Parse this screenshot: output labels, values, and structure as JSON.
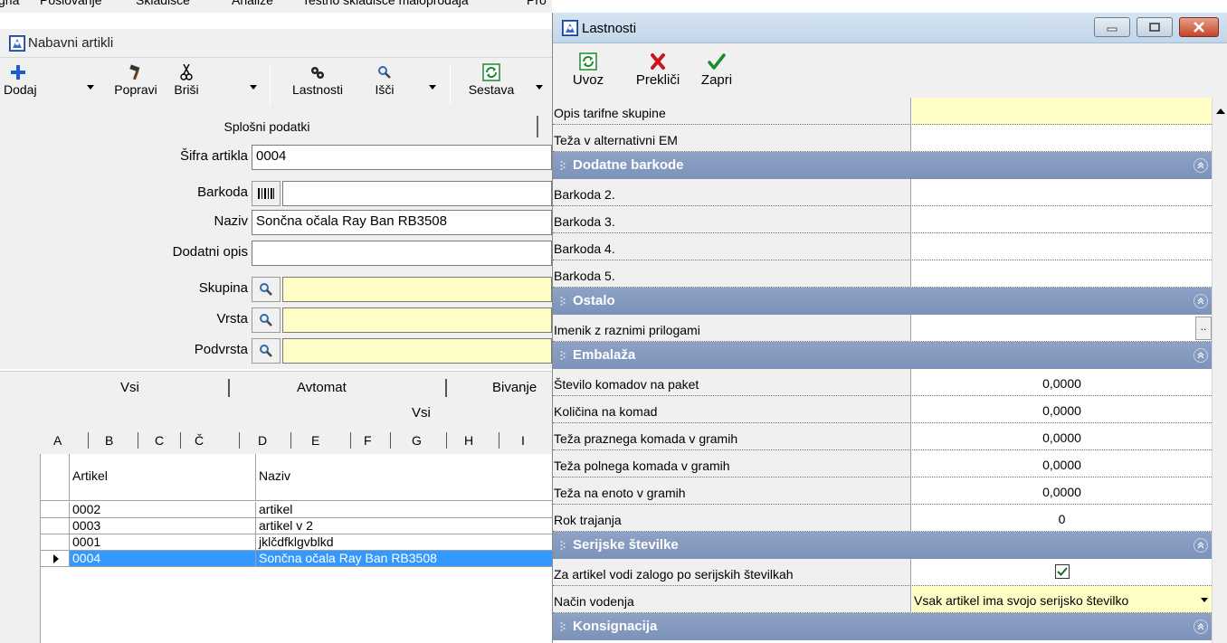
{
  "background_app": {
    "menu": [
      "gna",
      "Poslovanje",
      "Skladišče",
      "Analize",
      "Testno skladišče maloprodaja",
      "Pro"
    ],
    "window_title": "Nabavni artikli",
    "toolbar": {
      "add": "Dodaj",
      "edit": "Popravi",
      "delete": "Briši",
      "properties": "Lastnosti",
      "search": "Išči",
      "compose": "Sestava"
    },
    "section_title": "Splošni podatki",
    "form": {
      "code_label": "Šifra artikla",
      "code_value": "0004",
      "barcode_label": "Barkoda",
      "barcode_value": "",
      "name_label": "Naziv",
      "name_value": "Sončna očala Ray Ban RB3508",
      "extra_label": "Dodatni opis",
      "extra_value": "",
      "group_label": "Skupina",
      "type_label": "Vrsta",
      "subtype_label": "Podvrsta"
    },
    "tabs": [
      "Vsi",
      "Avtomat",
      "Bivanje"
    ],
    "filter_label": "Vsi",
    "letters": [
      "A",
      "B",
      "C",
      "Č",
      "D",
      "E",
      "F",
      "G",
      "H",
      "I"
    ],
    "grid": {
      "columns": [
        "Artikel",
        "Naziv"
      ],
      "rows": [
        {
          "code": "0002",
          "name": "artikel"
        },
        {
          "code": "0003",
          "name": "artikel v 2"
        },
        {
          "code": "0001",
          "name": "jklčdfklgvblkd"
        },
        {
          "code": "0004",
          "name": "Sončna očala Ray Ban RB3508"
        }
      ],
      "selected_index": 3
    }
  },
  "dialog": {
    "title": "Lastnosti",
    "toolbar": {
      "import": "Uvoz",
      "cancel": "Prekliči",
      "close": "Zapri"
    },
    "properties": {
      "tariff_desc": {
        "label": "Opis tarifne skupine",
        "value": ""
      },
      "alt_weight": {
        "label": "Teža v alternativni EM",
        "value": ""
      },
      "cat_barcodes": "Dodatne barkode",
      "barcode2": {
        "label": "Barkoda 2.",
        "value": ""
      },
      "barcode3": {
        "label": "Barkoda 3.",
        "value": ""
      },
      "barcode4": {
        "label": "Barkoda 4.",
        "value": ""
      },
      "barcode5": {
        "label": "Barkoda 5.",
        "value": ""
      },
      "cat_other": "Ostalo",
      "attachments_dir": {
        "label": "Imenik z raznimi prilogami",
        "value": ""
      },
      "cat_packaging": "Embalaža",
      "pieces_per_pack": {
        "label": "Število komadov na paket",
        "value": "0,0000"
      },
      "qty_per_piece": {
        "label": "Količina na komad",
        "value": "0,0000"
      },
      "empty_weight": {
        "label": "Teža praznega komada v gramih",
        "value": "0,0000"
      },
      "full_weight": {
        "label": "Teža polnega komada v gramih",
        "value": "0,0000"
      },
      "unit_weight": {
        "label": "Teža na enoto v gramih",
        "value": "0,0000"
      },
      "shelf_life": {
        "label": "Rok trajanja",
        "value": "0"
      },
      "cat_serials": "Serijske številke",
      "serial_stock": {
        "label": "Za artikel vodi zalogo po serijskih številkah",
        "checked": true
      },
      "serial_mode": {
        "label": "Način vodenja",
        "value": "Vsak artikel ima svojo serijsko številko"
      },
      "cat_consignment": "Konsignacija"
    }
  },
  "colors": {
    "yellow_field": "#fffdc6",
    "category_header": "#8ea2c6",
    "selection": "#3399ff",
    "close_button": "#c5452a"
  },
  "icons": {
    "add": "plus-icon",
    "edit": "hammer-icon",
    "delete": "scissors-icon",
    "properties": "gears-icon",
    "search": "magnifier-icon",
    "compose": "recycle-icon",
    "import": "recycle-icon",
    "cancel": "red-x-icon",
    "close": "green-check-icon"
  }
}
